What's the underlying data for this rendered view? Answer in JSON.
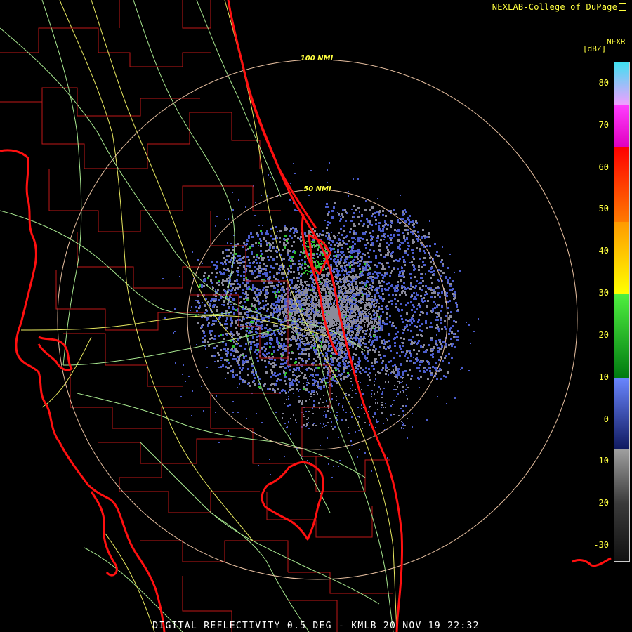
{
  "credit": "NEXLAB-College of DuPage",
  "footer": "DIGITAL REFLECTIVITY 0.5 DEG - KMLB 20 NOV 19 22:32",
  "legend": {
    "product": "NEXR",
    "unit": "[dBZ]",
    "ticks": [
      "80",
      "70",
      "60",
      "50",
      "40",
      "30",
      "20",
      "10",
      "0",
      "-10",
      "-20",
      "-30"
    ],
    "scale": [
      {
        "from": 85,
        "to": 75,
        "top": "#40e0f0",
        "bottom": "#f0a0ff"
      },
      {
        "from": 75,
        "to": 65,
        "top": "#ff40ff",
        "bottom": "#e000c0"
      },
      {
        "from": 65,
        "to": 47,
        "top": "#ff0000",
        "bottom": "#ff7a00"
      },
      {
        "from": 47,
        "to": 30,
        "top": "#ff9900",
        "bottom": "#ffff00"
      },
      {
        "from": 30,
        "to": 10,
        "top": "#50f040",
        "bottom": "#007a10"
      },
      {
        "from": 10,
        "to": -7,
        "top": "#6a86ff",
        "bottom": "#101a60"
      },
      {
        "from": -7,
        "to": -20,
        "top": "#a0a0a0",
        "bottom": "#3a3a3a"
      },
      {
        "from": -20,
        "to": -34,
        "top": "#3a3a3a",
        "bottom": "#101010"
      }
    ]
  },
  "range_rings": [
    {
      "label": "100 NMI",
      "radius_nmi": 100
    },
    {
      "label": "50 NMI",
      "radius_nmi": 50
    }
  ],
  "colors": {
    "coastline": "#ff1010",
    "county_lines": "#c01818",
    "highways": "#e8e860",
    "roads": "#a8e890",
    "range_rings": "#e8c0a0",
    "ring_labels": "#ffff40",
    "echo_light": "#4a5ccc",
    "echo_gray": "#8a8a9a",
    "echo_green": "#30c030"
  }
}
